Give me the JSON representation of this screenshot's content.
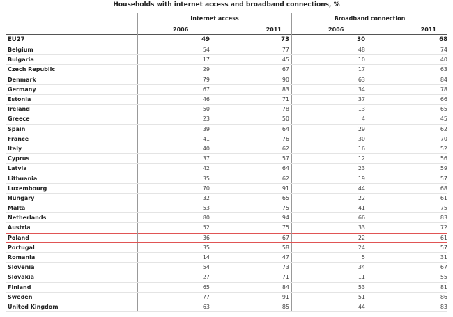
{
  "title": "Households with internet access and broadband connections, %",
  "headers": {
    "group_internet": "Internet access",
    "group_broadband": "Broadband connection",
    "year_2006": "2006",
    "year_2011": "2011"
  },
  "eu": {
    "country": "EU27",
    "ia2006": "49",
    "ia2011": "73",
    "bb2006": "30",
    "bb2011": "68"
  },
  "rows": [
    {
      "country": "Belgium",
      "ia2006": "54",
      "ia2011": "77",
      "bb2006": "48",
      "bb2011": "74"
    },
    {
      "country": "Bulgaria",
      "ia2006": "17",
      "ia2011": "45",
      "bb2006": "10",
      "bb2011": "40"
    },
    {
      "country": "Czech Republic",
      "ia2006": "29",
      "ia2011": "67",
      "bb2006": "17",
      "bb2011": "63"
    },
    {
      "country": "Denmark",
      "ia2006": "79",
      "ia2011": "90",
      "bb2006": "63",
      "bb2011": "84"
    },
    {
      "country": "Germany",
      "ia2006": "67",
      "ia2011": "83",
      "bb2006": "34",
      "bb2011": "78"
    },
    {
      "country": "Estonia",
      "ia2006": "46",
      "ia2011": "71",
      "bb2006": "37",
      "bb2011": "66"
    },
    {
      "country": "Ireland",
      "ia2006": "50",
      "ia2011": "78",
      "bb2006": "13",
      "bb2011": "65"
    },
    {
      "country": "Greece",
      "ia2006": "23",
      "ia2011": "50",
      "bb2006": "4",
      "bb2011": "45"
    },
    {
      "country": "Spain",
      "ia2006": "39",
      "ia2011": "64",
      "bb2006": "29",
      "bb2011": "62"
    },
    {
      "country": "France",
      "ia2006": "41",
      "ia2011": "76",
      "bb2006": "30",
      "bb2011": "70"
    },
    {
      "country": "Italy",
      "ia2006": "40",
      "ia2011": "62",
      "bb2006": "16",
      "bb2011": "52"
    },
    {
      "country": "Cyprus",
      "ia2006": "37",
      "ia2011": "57",
      "bb2006": "12",
      "bb2011": "56"
    },
    {
      "country": "Latvia",
      "ia2006": "42",
      "ia2011": "64",
      "bb2006": "23",
      "bb2011": "59"
    },
    {
      "country": "Lithuania",
      "ia2006": "35",
      "ia2011": "62",
      "bb2006": "19",
      "bb2011": "57"
    },
    {
      "country": "Luxembourg",
      "ia2006": "70",
      "ia2011": "91",
      "bb2006": "44",
      "bb2011": "68"
    },
    {
      "country": "Hungary",
      "ia2006": "32",
      "ia2011": "65",
      "bb2006": "22",
      "bb2011": "61"
    },
    {
      "country": "Malta",
      "ia2006": "53",
      "ia2011": "75",
      "bb2006": "41",
      "bb2011": "75"
    },
    {
      "country": "Netherlands",
      "ia2006": "80",
      "ia2011": "94",
      "bb2006": "66",
      "bb2011": "83"
    },
    {
      "country": "Austria",
      "ia2006": "52",
      "ia2011": "75",
      "bb2006": "33",
      "bb2011": "72"
    },
    {
      "country": "Poland",
      "ia2006": "36",
      "ia2011": "67",
      "bb2006": "22",
      "bb2011": "61",
      "highlight": true
    },
    {
      "country": "Portugal",
      "ia2006": "35",
      "ia2011": "58",
      "bb2006": "24",
      "bb2011": "57"
    },
    {
      "country": "Romania",
      "ia2006": "14",
      "ia2011": "47",
      "bb2006": "5",
      "bb2011": "31"
    },
    {
      "country": "Slovenia",
      "ia2006": "54",
      "ia2011": "73",
      "bb2006": "34",
      "bb2011": "67"
    },
    {
      "country": "Slovakia",
      "ia2006": "27",
      "ia2011": "71",
      "bb2006": "11",
      "bb2011": "55"
    },
    {
      "country": "Finland",
      "ia2006": "65",
      "ia2011": "84",
      "bb2006": "53",
      "bb2011": "81"
    },
    {
      "country": "Sweden",
      "ia2006": "77",
      "ia2011": "91",
      "bb2006": "51",
      "bb2011": "86"
    },
    {
      "country": "United Kingdom",
      "ia2006": "63",
      "ia2011": "85",
      "bb2006": "44",
      "bb2011": "83"
    }
  ],
  "colors": {
    "highlight_border": "#e05555"
  }
}
